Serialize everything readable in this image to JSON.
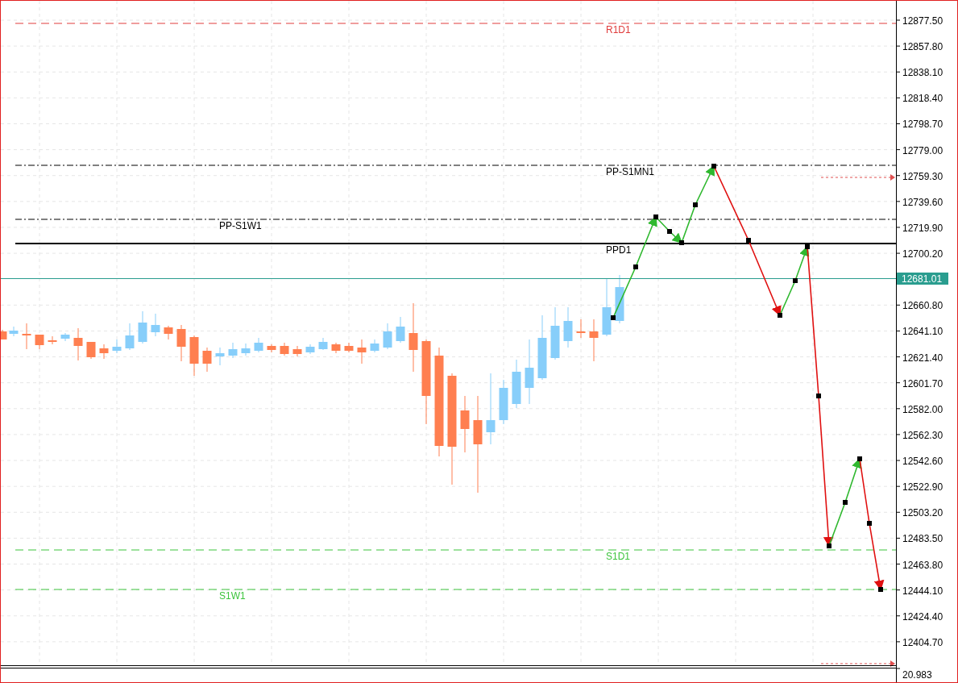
{
  "levels": [
    {
      "label": "R1D1",
      "kind": "dashed",
      "color": "#e03c3c"
    },
    {
      "label": "PP-S1MN1",
      "kind": "dash-dot",
      "color": "#000000"
    },
    {
      "label": "PP-S1W1",
      "kind": "dash-dot",
      "color": "#000000"
    },
    {
      "label": "PPD1",
      "kind": "solid",
      "color": "#000000"
    },
    {
      "label": "S1D1",
      "kind": "dashed",
      "color": "#3cc43c"
    },
    {
      "label": "S1W1",
      "kind": "dashed",
      "color": "#3cc43c"
    }
  ],
  "price_axis": [
    "12877.50",
    "12857.80",
    "12838.10",
    "12818.40",
    "12798.70",
    "12779.00",
    "12759.30",
    "12739.60",
    "12719.90",
    "12700.20",
    "12660.80",
    "12641.10",
    "12621.40",
    "12601.70",
    "12582.00",
    "12562.30",
    "12542.60",
    "12522.90",
    "12503.20",
    "12483.50",
    "12463.80",
    "12444.10",
    "12424.40",
    "12404.70"
  ],
  "current_price": "12681.01",
  "indicator_panel": {
    "value": "20.983"
  }
}
